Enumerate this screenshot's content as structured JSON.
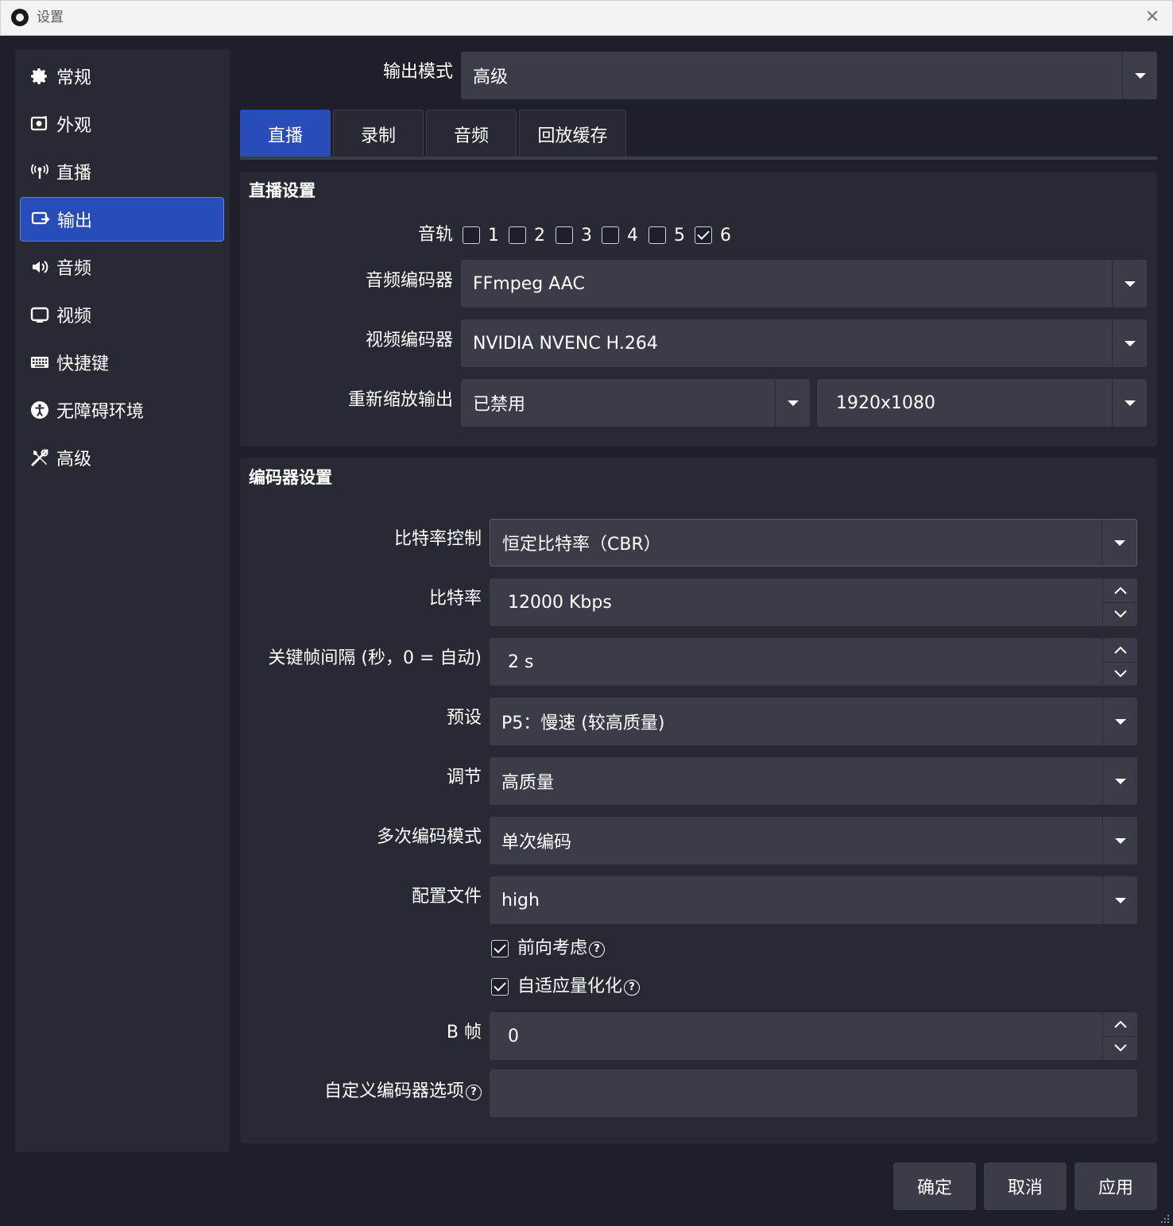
{
  "window": {
    "title": "设置"
  },
  "sidebar": {
    "items": [
      {
        "label": "常规",
        "icon": "gear-icon"
      },
      {
        "label": "外观",
        "icon": "appearance-icon"
      },
      {
        "label": "直播",
        "icon": "antenna-icon"
      },
      {
        "label": "输出",
        "icon": "output-icon",
        "active": true
      },
      {
        "label": "音频",
        "icon": "speaker-icon"
      },
      {
        "label": "视频",
        "icon": "monitor-icon"
      },
      {
        "label": "快捷键",
        "icon": "keyboard-icon"
      },
      {
        "label": "无障碍环境",
        "icon": "accessibility-icon"
      },
      {
        "label": "高级",
        "icon": "tools-icon"
      }
    ]
  },
  "output_mode": {
    "label": "输出模式",
    "value": "高级"
  },
  "tabs": [
    {
      "label": "直播",
      "active": true
    },
    {
      "label": "录制"
    },
    {
      "label": "音频"
    },
    {
      "label": "回放缓存"
    }
  ],
  "stream_settings": {
    "title": "直播设置",
    "tracks_label": "音轨",
    "tracks": [
      {
        "label": "1",
        "checked": false
      },
      {
        "label": "2",
        "checked": false
      },
      {
        "label": "3",
        "checked": false
      },
      {
        "label": "4",
        "checked": false
      },
      {
        "label": "5",
        "checked": false
      },
      {
        "label": "6",
        "checked": true
      }
    ],
    "audio_encoder_label": "音频编码器",
    "audio_encoder": "FFmpeg AAC",
    "video_encoder_label": "视频编码器",
    "video_encoder": "NVIDIA NVENC H.264",
    "rescale_label": "重新缩放输出",
    "rescale_mode": "已禁用",
    "rescale_resolution": "1920x1080"
  },
  "encoder_settings": {
    "title": "编码器设置",
    "rate_control_label": "比特率控制",
    "rate_control": "恒定比特率（CBR）",
    "bitrate_label": "比特率",
    "bitrate": "12000 Kbps",
    "keyframe_label": "关键帧间隔 (秒，0 = 自动)",
    "keyframe": "2 s",
    "preset_label": "预设",
    "preset": "P5：慢速 (较高质量)",
    "tuning_label": "调节",
    "tuning": "高质量",
    "multipass_label": "多次编码模式",
    "multipass": "单次编码",
    "profile_label": "配置文件",
    "profile": "high",
    "lookahead_label": "前向考虑",
    "lookahead_checked": true,
    "aq_label": "自适应量化化",
    "aq_checked": true,
    "bframes_label": "B 帧",
    "bframes": "0",
    "custom_label": "自定义编码器选项",
    "custom_value": ""
  },
  "footer": {
    "ok": "确定",
    "cancel": "取消",
    "apply": "应用"
  },
  "colors": {
    "accent": "#284cb8",
    "panel": "#272a33",
    "field": "#3a3d47",
    "background": "#1e1f29"
  }
}
